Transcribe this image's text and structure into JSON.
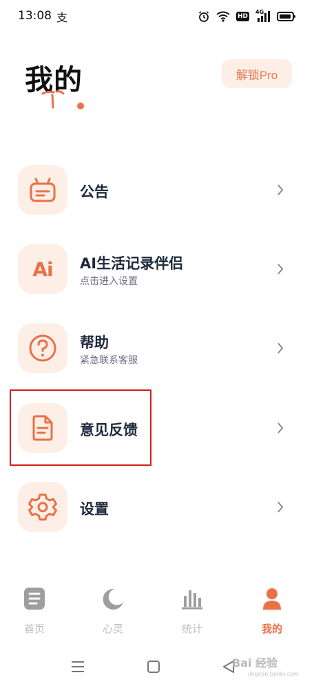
{
  "status_bar": {
    "time": "13:08",
    "app_icon_glyph": "支",
    "icons": [
      "alarm-icon",
      "wifi-icon",
      "hd-icon",
      "signal-4g-icon",
      "battery-icon"
    ],
    "hd_label": "HD",
    "network_label": "4G"
  },
  "header": {
    "title": "我的",
    "unlock_label": "解锁Pro"
  },
  "menu": [
    {
      "title": "公告",
      "subtitle": "",
      "icon": "announcement-icon"
    },
    {
      "title": "AI生活记录伴侣",
      "subtitle": "点击进入设置",
      "icon": "ai-icon",
      "icon_text": "Ai"
    },
    {
      "title": "帮助",
      "subtitle": "紧急联系客服",
      "icon": "help-icon"
    },
    {
      "title": "意见反馈",
      "subtitle": "",
      "icon": "feedback-icon"
    },
    {
      "title": "设置",
      "subtitle": "",
      "icon": "settings-icon"
    }
  ],
  "bottom_nav": [
    {
      "label": "首页",
      "icon": "home-doc-icon",
      "active": false
    },
    {
      "label": "心灵",
      "icon": "moon-icon",
      "active": false
    },
    {
      "label": "统计",
      "icon": "bar-chart-icon",
      "active": false
    },
    {
      "label": "我的",
      "icon": "person-icon",
      "active": true
    }
  ],
  "watermark": {
    "text": "Bai 经验",
    "sub": "jingyan.baidu.com"
  },
  "colors": {
    "accent": "#ea7047",
    "icon_bg": "#fdeee6",
    "highlight": "#d21d1d",
    "inactive": "#bdbdbd"
  }
}
